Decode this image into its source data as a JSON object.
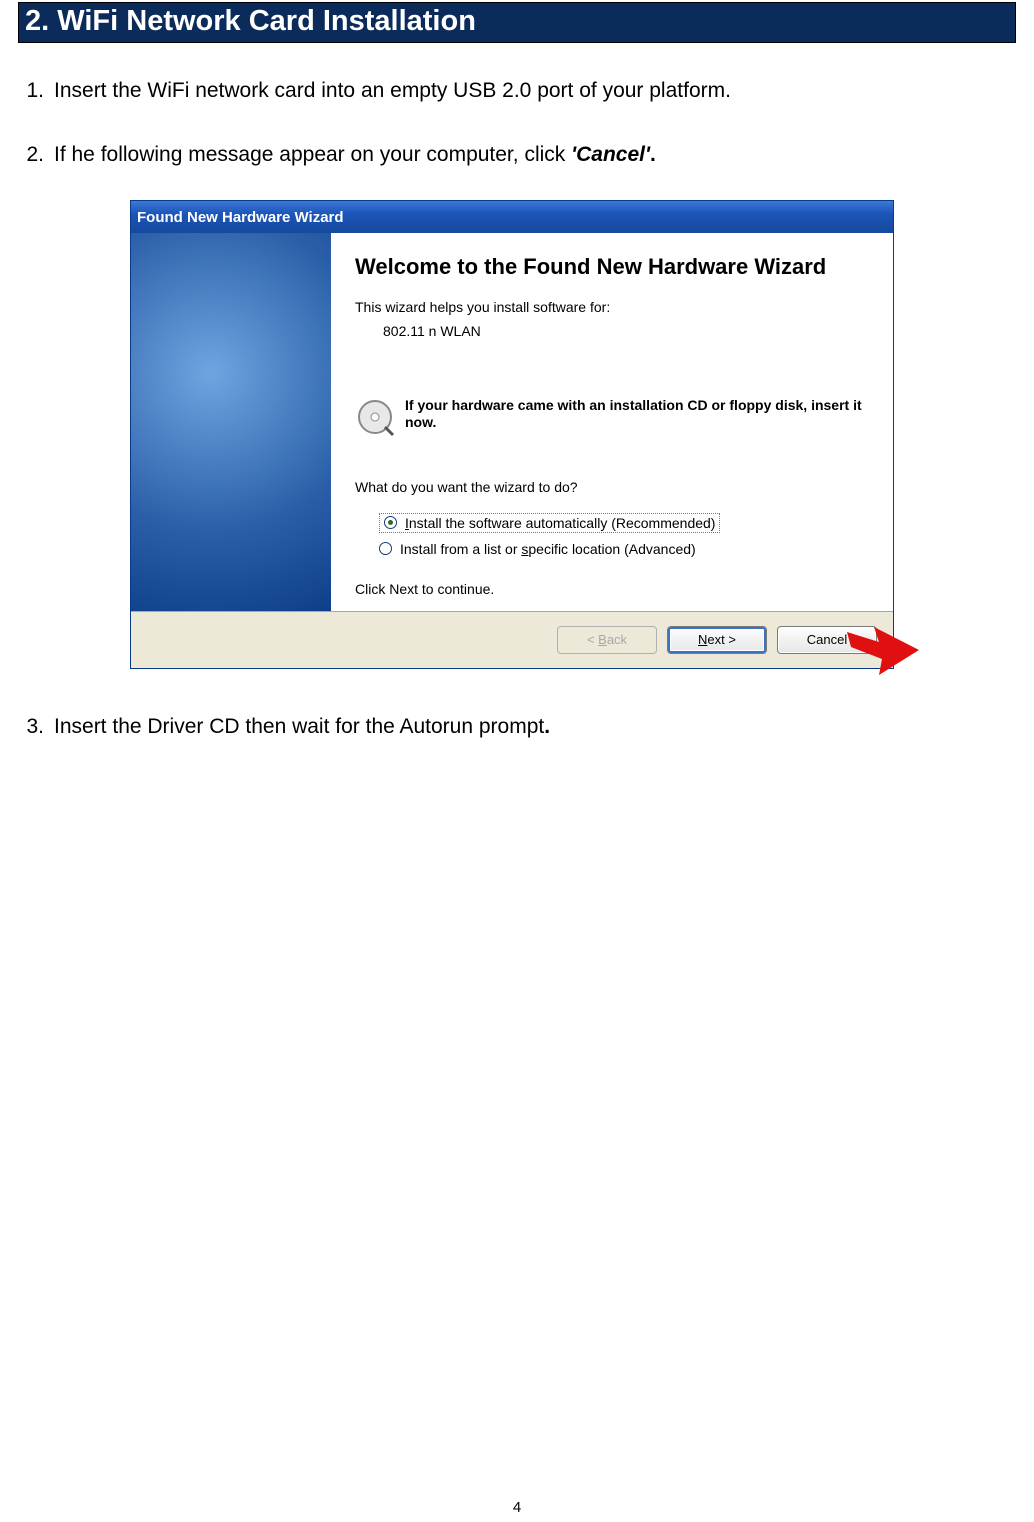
{
  "header": {
    "title": "2. WiFi Network Card Installation"
  },
  "steps": [
    {
      "num": "1.",
      "text": "Insert the WiFi network card into an empty USB 2.0 port of your platform."
    },
    {
      "num": "2.",
      "text_prefix": "If he following message appear on your computer, click ",
      "text_bold": "'Cancel'",
      "text_suffix": "."
    },
    {
      "num": "3.",
      "text": "Insert the Driver CD then wait for the Autorun prompt",
      "text_suffix_bold": "."
    }
  ],
  "wizard": {
    "title": "Found New Hardware Wizard",
    "heading": "Welcome to the Found New Hardware Wizard",
    "helps": "This wizard helps you install software for:",
    "device": "802.11 n WLAN",
    "cd_text": "If your hardware came with an installation CD or floppy disk, insert it now.",
    "question": "What do you want the wizard to do?",
    "radio1": "Install the software automatically (Recommended)",
    "radio1_ul": "I",
    "radio2": "Install from a list or specific location (Advanced)",
    "radio2_ul": "s",
    "clicknext": "Click Next to continue.",
    "back": "< Back",
    "back_ul": "B",
    "next": "Next >",
    "next_ul": "N",
    "cancel": "Cancel"
  },
  "page_number": "4"
}
